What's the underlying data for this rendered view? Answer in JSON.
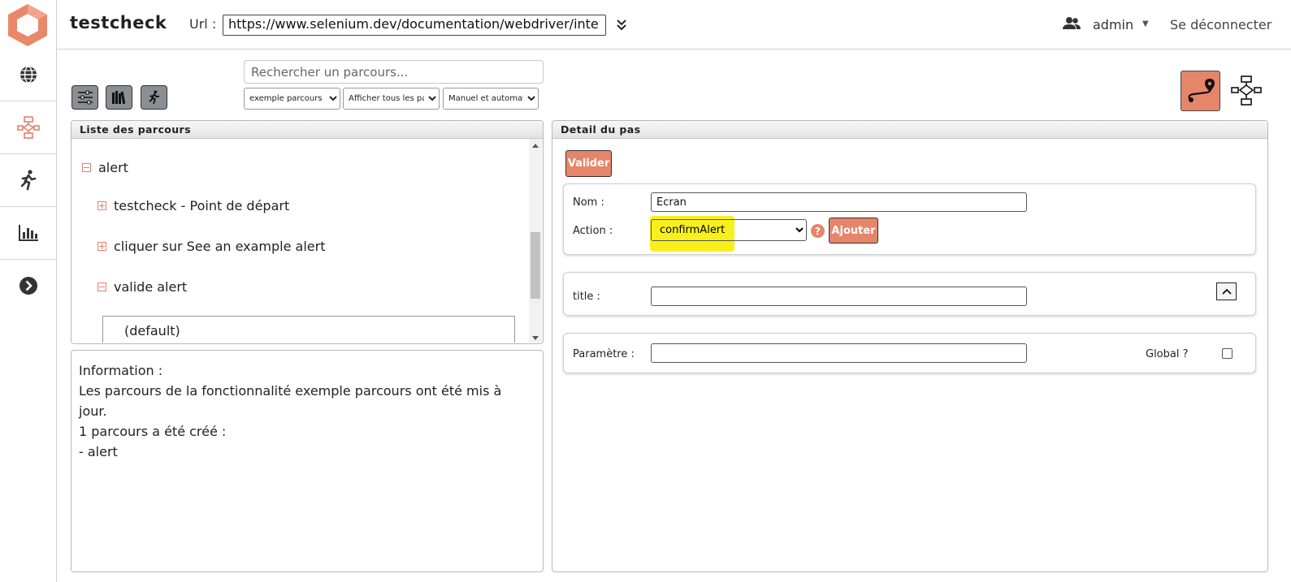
{
  "header": {
    "app_title": "testcheck",
    "url_label": "Url :",
    "url_value": "https://www.selenium.dev/documentation/webdriver/inte",
    "user_name": "admin",
    "logout_label": "Se déconnecter"
  },
  "toolbar": {
    "search_placeholder": "Rechercher un parcours...",
    "filter_feature": "exemple parcours",
    "filter_display": "Afficher tous les par",
    "filter_mode": "Manuel et automatis"
  },
  "list_panel": {
    "title": "Liste des parcours",
    "tree": [
      {
        "label": "alert",
        "state": "expanded",
        "level": 0
      },
      {
        "label": "testcheck - Point de départ",
        "state": "collapsed",
        "level": 1
      },
      {
        "label": "cliquer sur See an example alert",
        "state": "collapsed",
        "level": 1
      },
      {
        "label": "valide alert",
        "state": "expanded",
        "level": 1
      }
    ],
    "sub_item": "(default)"
  },
  "info_panel": {
    "line1": "Information :",
    "line2": "Les parcours de la fonctionnalité exemple parcours ont été mis à",
    "line3": "jour.",
    "line4": "1 parcours a été créé :",
    "line5": "- alert"
  },
  "detail_panel": {
    "title": "Detail du pas",
    "validate_label": "Valider",
    "name_label": "Nom :",
    "name_value": "Ecran",
    "action_label": "Action :",
    "action_value": "confirmAlert",
    "help_glyph": "?",
    "add_label": "Ajouter",
    "title_label": "title :",
    "title_value": "",
    "param_label": "Paramètre :",
    "param_value": "",
    "global_label": "Global ?"
  },
  "colors": {
    "accent": "#e5856a",
    "highlight": "#f7f01c",
    "toolbar_button": "#8a8f94"
  }
}
